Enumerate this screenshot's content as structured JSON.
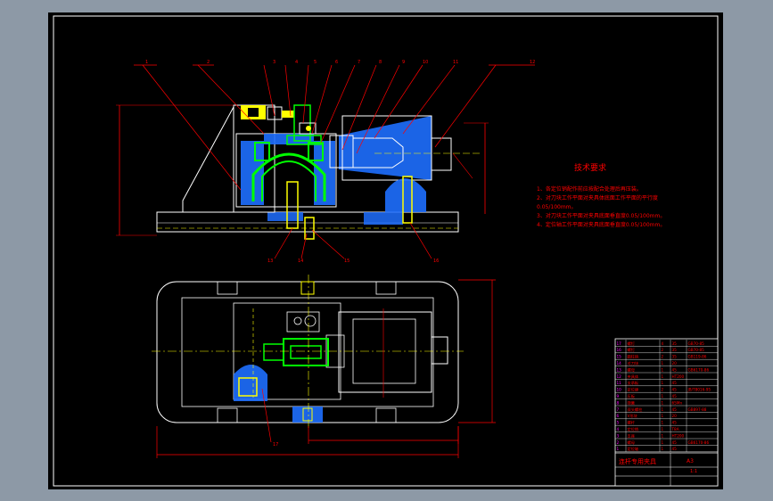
{
  "drawing": {
    "background_color": "#000000",
    "frame_color": "#ffffff",
    "outline_color": "#ffffff",
    "dimension_color": "#ff0000",
    "part_color": "#00ff00",
    "section_color": "#1e6fff",
    "centerline_color": "#ffff00"
  },
  "tech_requirements": {
    "title": "技术要求",
    "items": [
      "1、各定位销配作前应按配合处理后再压装。",
      "2、对刀块工作平面对夹具体底面工作平面的平行度",
      "0.05/100mm。",
      "3、对刀块工作平面对夹具底面垂直度0.05/100mm。",
      "4、定位轴工作平面对夹具底面垂直度0.05/100mm。"
    ]
  },
  "balloons": {
    "top": [
      "1",
      "2",
      "3",
      "4",
      "5",
      "6",
      "7",
      "8",
      "9",
      "10",
      "11",
      "12"
    ],
    "bottom": [
      "13",
      "14",
      "15",
      "16"
    ],
    "plan": [
      "17"
    ]
  },
  "title_block": {
    "drawing_title": "连杆专用夹具",
    "scale": "1:1",
    "sheet": "A3",
    "rows": [
      {
        "no": "17",
        "name": "螺钉",
        "qty": "4",
        "mat": "35",
        "std": "GB70-85"
      },
      {
        "no": "16",
        "name": "螺钉",
        "qty": "2",
        "mat": "35",
        "std": "GB70-85"
      },
      {
        "no": "15",
        "name": "圆柱销",
        "qty": "2",
        "mat": "35",
        "std": "GB119-86"
      },
      {
        "no": "14",
        "name": "对刀块",
        "qty": "1",
        "mat": "20",
        "std": ""
      },
      {
        "no": "13",
        "name": "螺母",
        "qty": "1",
        "mat": "45",
        "std": "GB6170-86"
      },
      {
        "no": "12",
        "name": "夹具体",
        "qty": "1",
        "mat": "HT200",
        "std": ""
      },
      {
        "no": "11",
        "name": "支承板",
        "qty": "1",
        "mat": "45",
        "std": ""
      },
      {
        "no": "10",
        "name": "定位键",
        "qty": "2",
        "mat": "45",
        "std": "JB/T8016-95"
      },
      {
        "no": "9",
        "name": "压板",
        "qty": "1",
        "mat": "45",
        "std": ""
      },
      {
        "no": "8",
        "name": "弹簧",
        "qty": "1",
        "mat": "65Mn",
        "std": ""
      },
      {
        "no": "7",
        "name": "双头螺柱",
        "qty": "1",
        "mat": "45",
        "std": "GB897-88"
      },
      {
        "no": "6",
        "name": "V形块",
        "qty": "1",
        "mat": "20",
        "std": ""
      },
      {
        "no": "5",
        "name": "螺杆",
        "qty": "1",
        "mat": "45",
        "std": ""
      },
      {
        "no": "4",
        "name": "定位销",
        "qty": "1",
        "mat": "T8A",
        "std": ""
      },
      {
        "no": "3",
        "name": "支座",
        "qty": "1",
        "mat": "HT200",
        "std": ""
      },
      {
        "no": "2",
        "name": "螺母",
        "qty": "1",
        "mat": "45",
        "std": "GB6170-86"
      },
      {
        "no": "1",
        "name": "定位轴",
        "qty": "1",
        "mat": "45",
        "std": ""
      }
    ]
  }
}
